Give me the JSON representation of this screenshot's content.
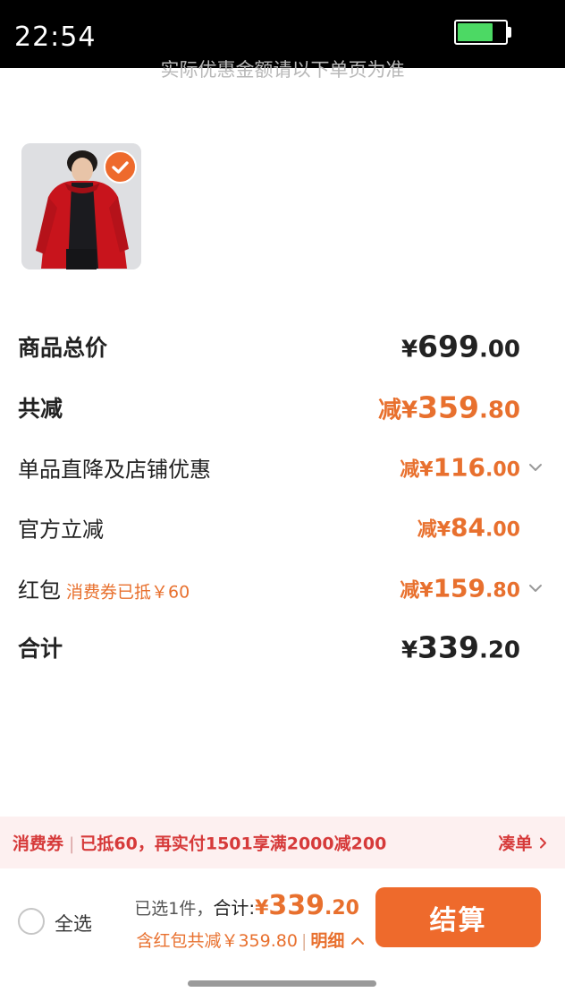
{
  "status_bar": {
    "time": "22:54",
    "battery_level": 0.75,
    "battery_color": "#4cd964"
  },
  "notice": "实际优惠金额请以下单页为准",
  "product": {
    "image": "red-winter-coat-photo",
    "selected": true
  },
  "summary": {
    "subtotal": {
      "label": "商品总价",
      "prefix": "¥",
      "int": "699",
      "dec": ".00"
    },
    "total_discount": {
      "label": "共减",
      "prefix": "减¥",
      "int": "359",
      "dec": ".80"
    },
    "shop_discount": {
      "label": "单品直降及店铺优惠",
      "prefix": "减¥",
      "int": "116",
      "dec": ".00"
    },
    "official_discount": {
      "label": "官方立减",
      "prefix": "减¥",
      "int": "84",
      "dec": ".00"
    },
    "red_packet": {
      "label": "红包",
      "note": "消费券已抵￥60",
      "prefix": "减¥",
      "int": "159",
      "dec": ".80"
    },
    "total": {
      "label": "合计",
      "prefix": "¥",
      "int": "339",
      "dec": ".20"
    }
  },
  "coupon_bar": {
    "tag": "消费券",
    "message": "已抵60，再实付1501享满2000减200",
    "link": "凑单"
  },
  "bottom_bar": {
    "select_all": "全选",
    "selected_count": "已选1件，",
    "total_label": "合计:",
    "total_prefix": "¥",
    "total_int": "339",
    "total_dec": ".20",
    "discount_note": "含红包共减￥359.80",
    "detail_link": "明细",
    "checkout": "结算"
  },
  "colors": {
    "accent": "#ee6a2c",
    "price_orange": "#e8702e",
    "coupon_red": "#d63a3a",
    "coupon_bg": "#fdf0f0"
  }
}
